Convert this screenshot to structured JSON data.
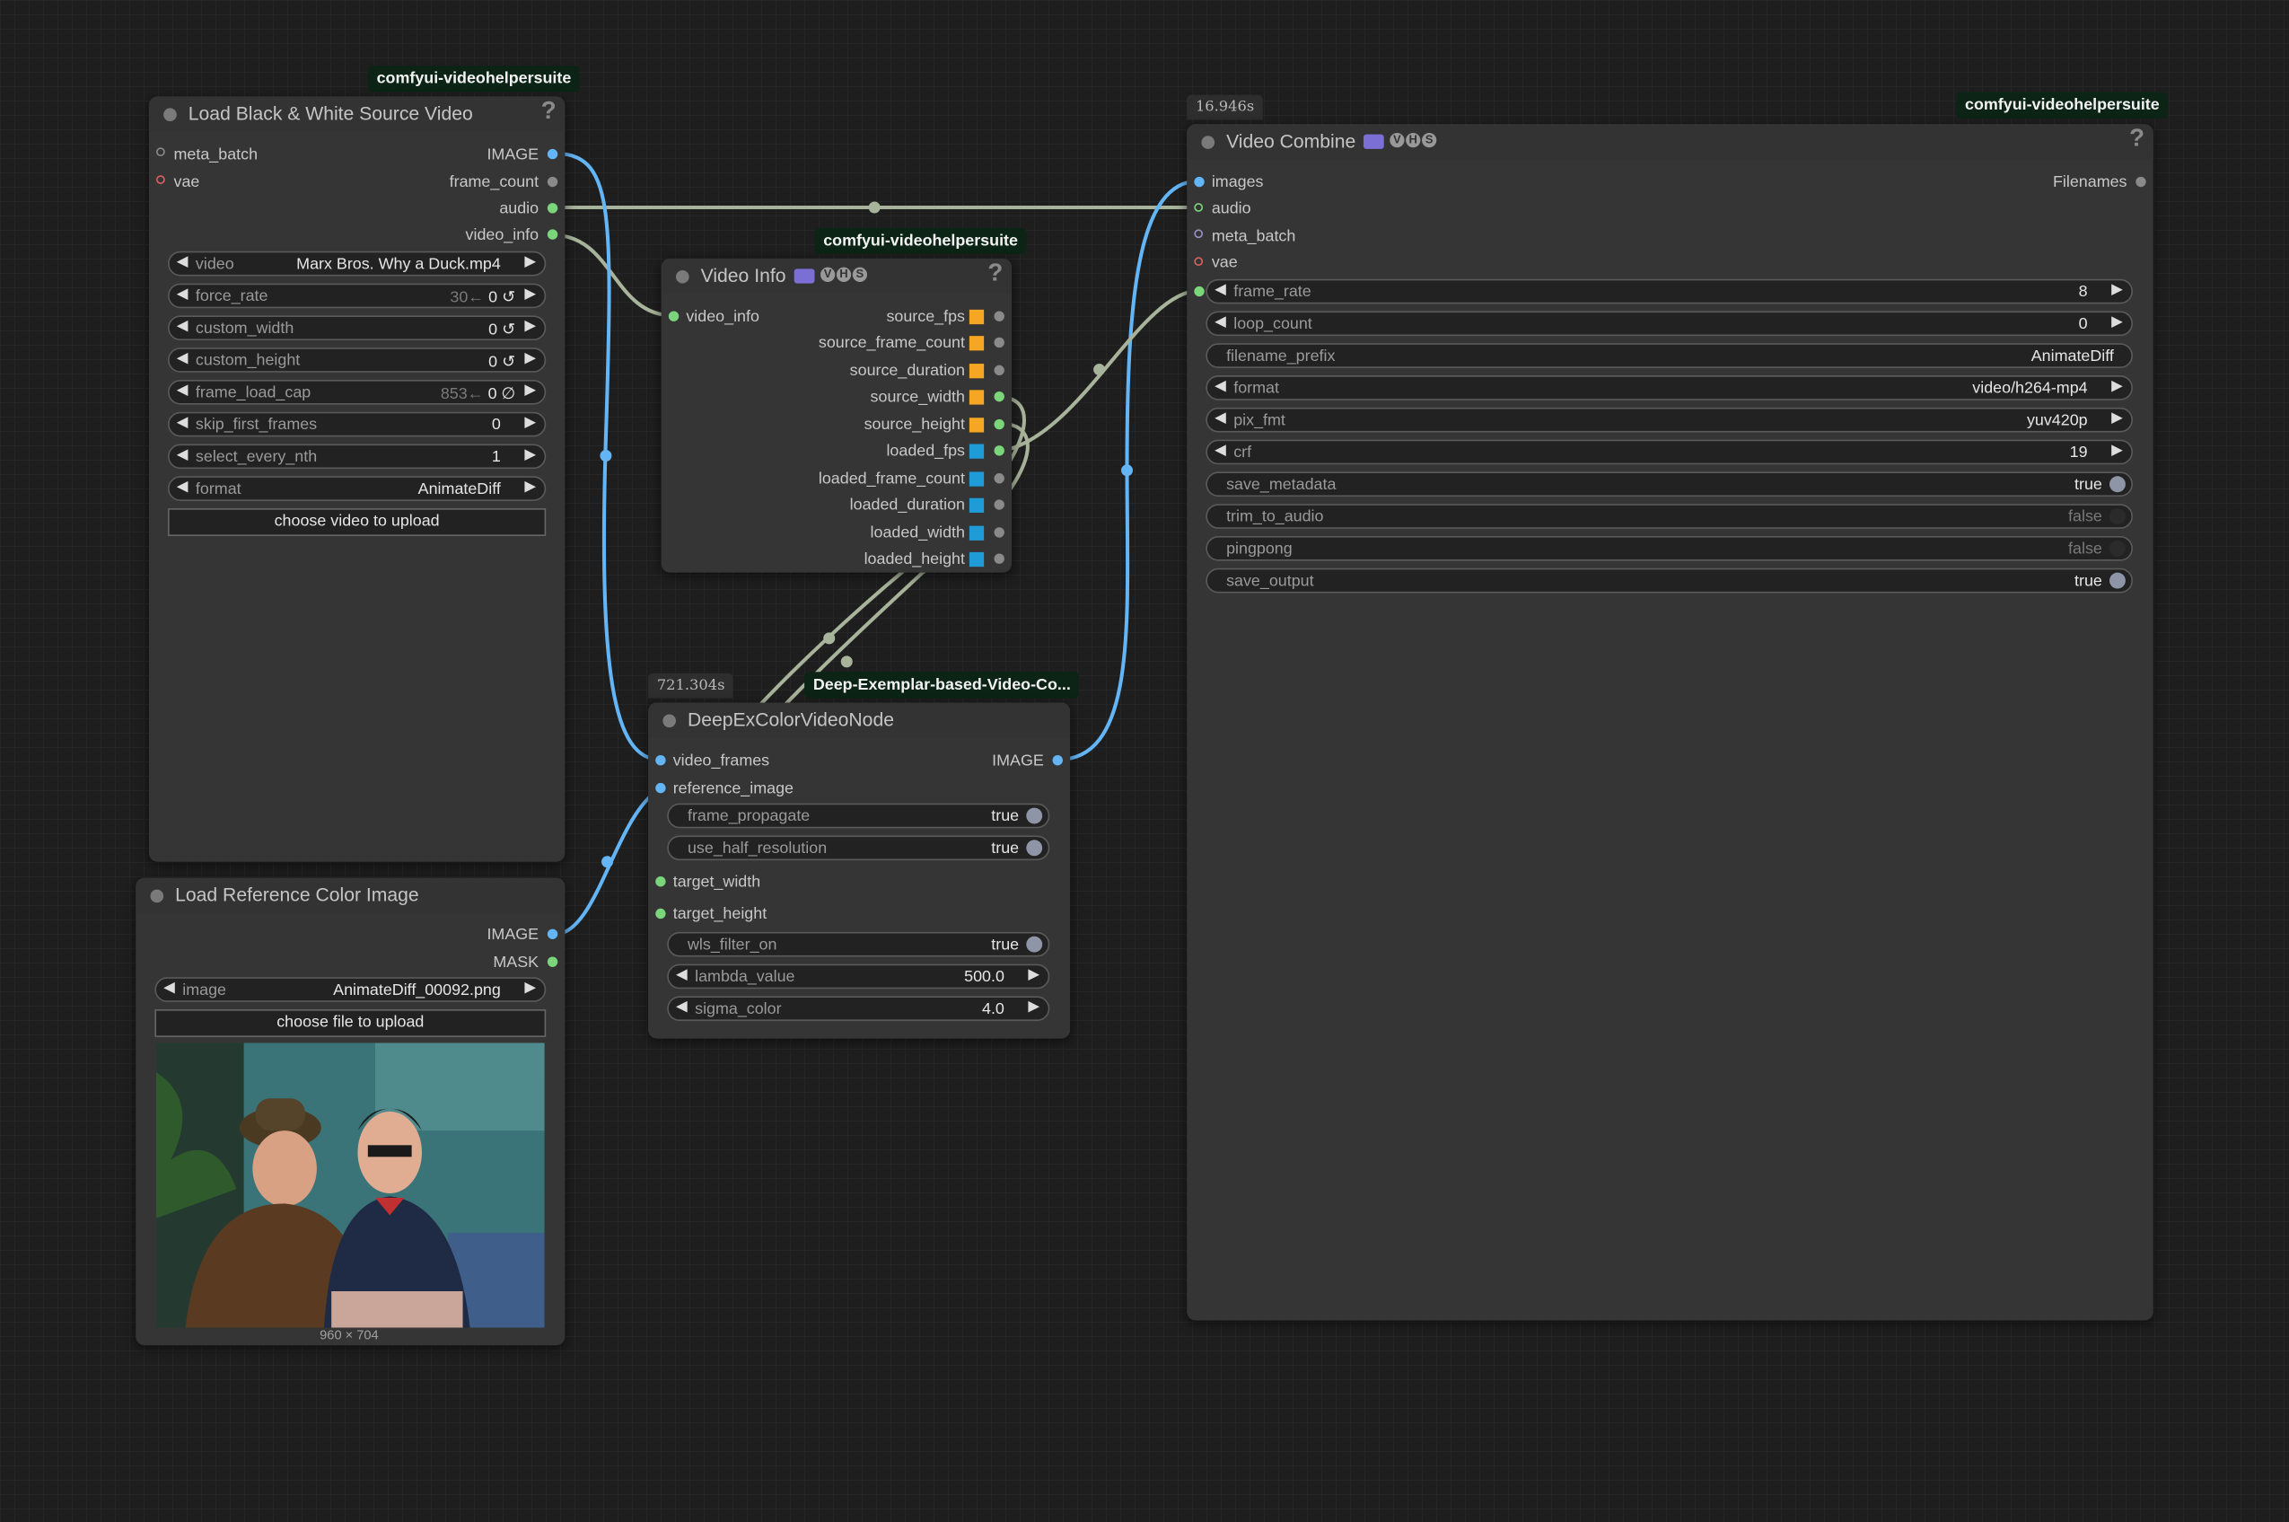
{
  "canvas": {
    "colors": {
      "background": "#1e1e1e",
      "node": "#353535",
      "image_wire": "#64b5f6",
      "audio_wire": "#a7b39a",
      "pack_label": "#0c2416"
    }
  },
  "nodes": {
    "load_video": {
      "pack": "comfyui-videohelpersuite",
      "title": "Load Black & White Source Video",
      "help": "?",
      "inputs": [
        "meta_batch",
        "vae"
      ],
      "outputs": [
        "IMAGE",
        "frame_count",
        "audio",
        "video_info"
      ],
      "widgets": {
        "video": {
          "label": "video",
          "value": "Marx Bros. Why a Duck.mp4"
        },
        "force_rate": {
          "label": "force_rate",
          "hint": "30←",
          "value": "0 ↺"
        },
        "custom_width": {
          "label": "custom_width",
          "value": "0 ↺"
        },
        "custom_height": {
          "label": "custom_height",
          "value": "0 ↺"
        },
        "frame_load_cap": {
          "label": "frame_load_cap",
          "hint": "853←",
          "value": "0 ∅"
        },
        "skip_first_frames": {
          "label": "skip_first_frames",
          "value": "0"
        },
        "select_every_nth": {
          "label": "select_every_nth",
          "value": "1"
        },
        "format": {
          "label": "format",
          "value": "AnimateDiff"
        }
      },
      "upload_button": "choose video to upload"
    },
    "load_image": {
      "title": "Load Reference Color Image",
      "outputs": [
        "IMAGE",
        "MASK"
      ],
      "widgets": {
        "image": {
          "label": "image",
          "value": "AnimateDiff_00092.png"
        }
      },
      "upload_button": "choose file to upload",
      "image_size": "960 × 704"
    },
    "video_info": {
      "pack": "comfyui-videohelpersuite",
      "title": "Video Info",
      "help": "?",
      "input": "video_info",
      "outputs": [
        "source_fps",
        "source_frame_count",
        "source_duration",
        "source_width",
        "source_height",
        "loaded_fps",
        "loaded_frame_count",
        "loaded_duration",
        "loaded_width",
        "loaded_height"
      ]
    },
    "deepex": {
      "pack": "Deep-Exemplar-based-Video-Co...",
      "timer": "721.304s",
      "title": "DeepExColorVideoNode",
      "inputs": [
        "video_frames",
        "reference_image"
      ],
      "output": "IMAGE",
      "widgets": {
        "frame_propagate": {
          "label": "frame_propagate",
          "value": "true"
        },
        "use_half_resolution": {
          "label": "use_half_resolution",
          "value": "true"
        },
        "target_width": "target_width",
        "target_height": "target_height",
        "wls_filter_on": {
          "label": "wls_filter_on",
          "value": "true"
        },
        "lambda_value": {
          "label": "lambda_value",
          "value": "500.0"
        },
        "sigma_color": {
          "label": "sigma_color",
          "value": "4.0"
        }
      }
    },
    "video_combine": {
      "pack": "comfyui-videohelpersuite",
      "timer": "16.946s",
      "title": "Video Combine",
      "help": "?",
      "inputs": [
        "images",
        "audio",
        "meta_batch",
        "vae"
      ],
      "output": "Filenames",
      "widgets": {
        "frame_rate": {
          "label": "frame_rate",
          "value": "8"
        },
        "loop_count": {
          "label": "loop_count",
          "value": "0"
        },
        "filename_prefix": {
          "label": "filename_prefix",
          "value": "AnimateDiff"
        },
        "format": {
          "label": "format",
          "value": "video/h264-mp4"
        },
        "pix_fmt": {
          "label": "pix_fmt",
          "value": "yuv420p"
        },
        "crf": {
          "label": "crf",
          "value": "19"
        },
        "save_metadata": {
          "label": "save_metadata",
          "value": "true"
        },
        "trim_to_audio": {
          "label": "trim_to_audio",
          "value": "false"
        },
        "pingpong": {
          "label": "pingpong",
          "value": "false"
        },
        "save_output": {
          "label": "save_output",
          "value": "true"
        }
      }
    }
  }
}
